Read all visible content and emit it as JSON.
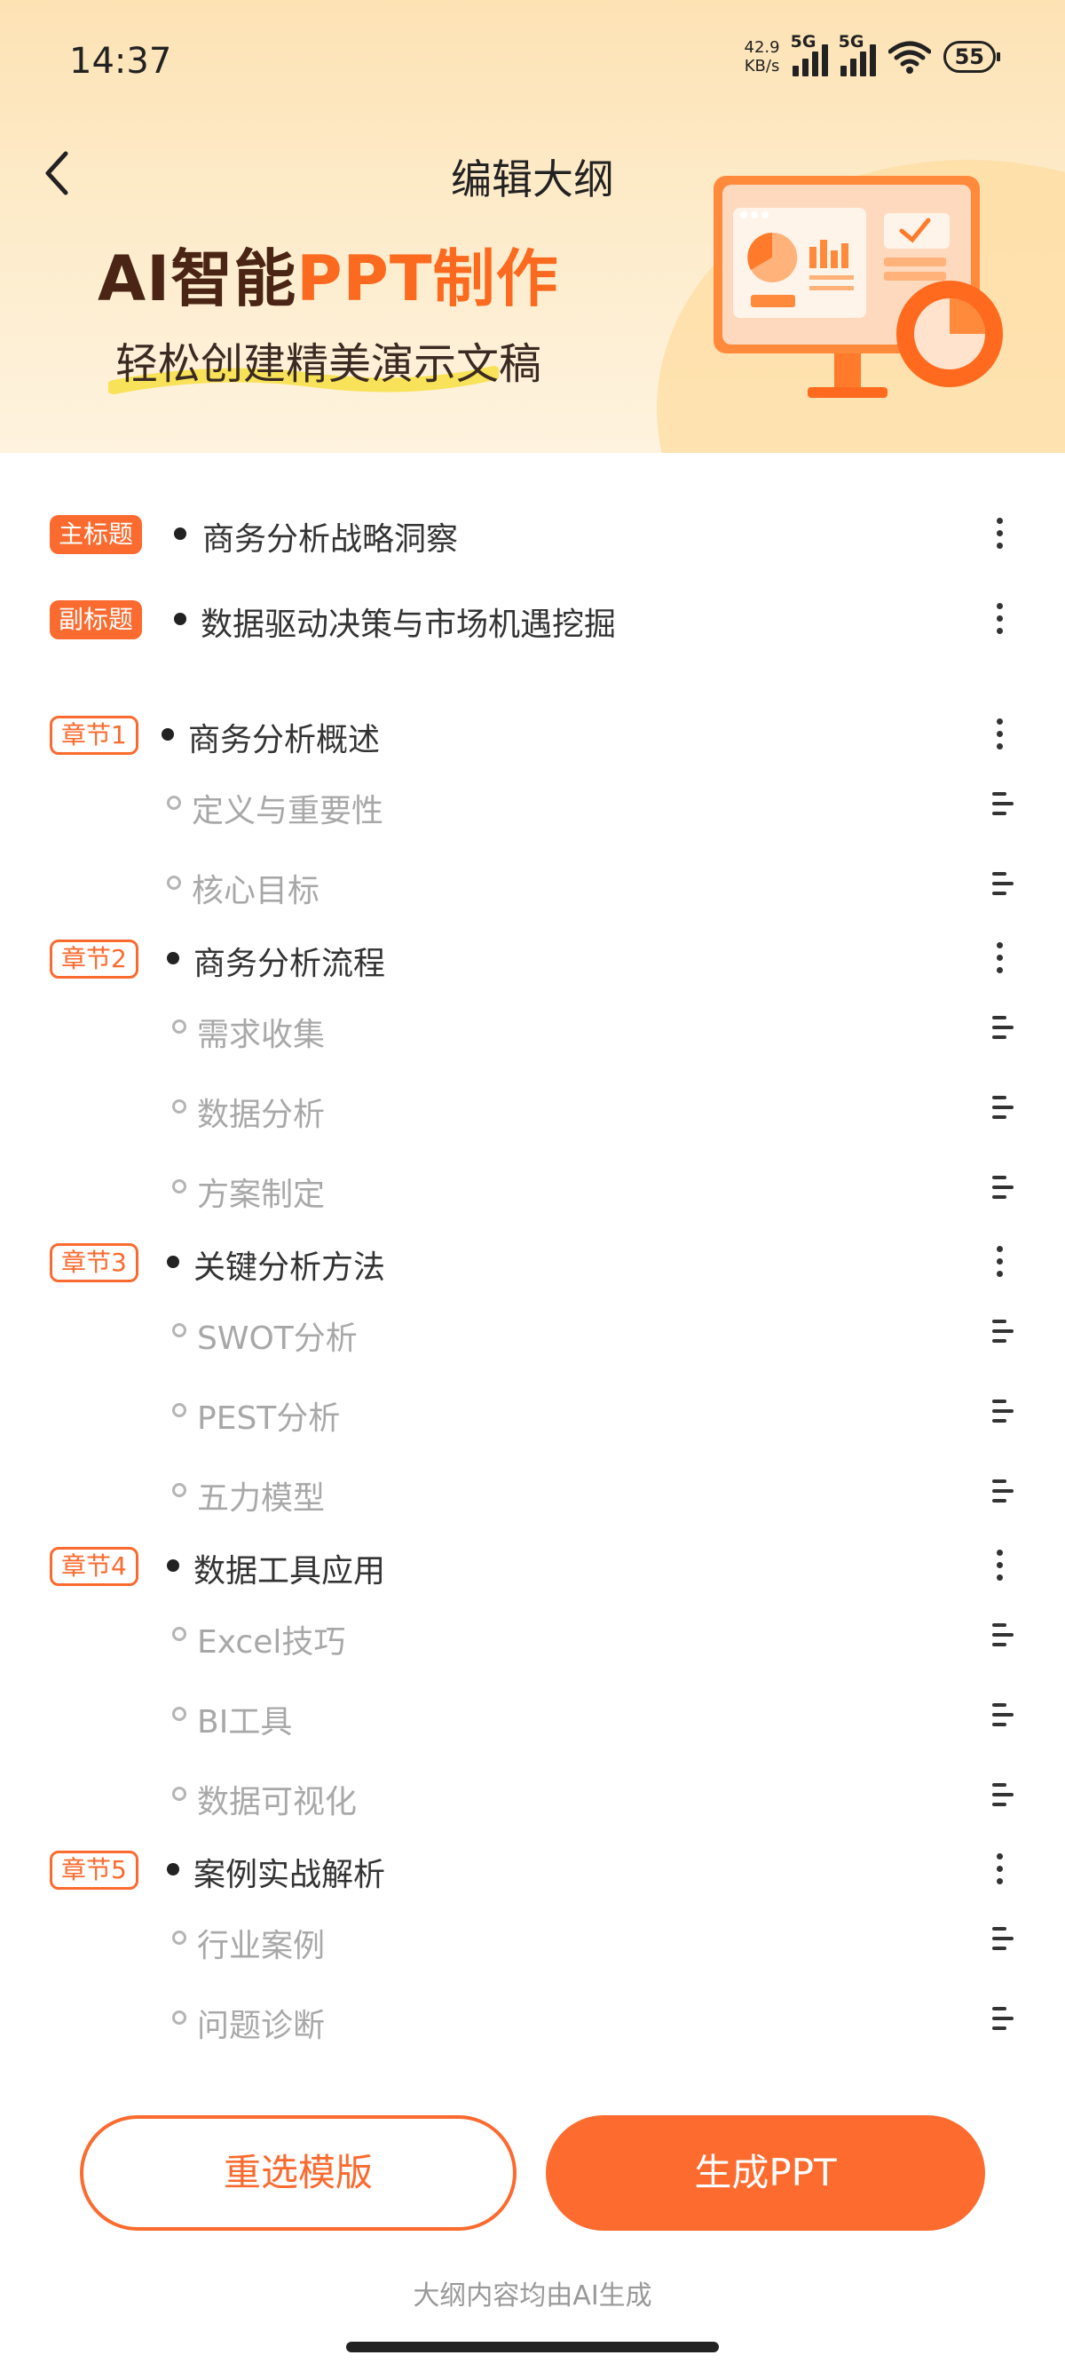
{
  "status": {
    "time": "14:37",
    "speed_value": "42.9",
    "speed_unit": "KB/s",
    "sim1": "5G",
    "sim2": "5G",
    "battery": "55",
    "icons": [
      "signal-icon",
      "signal-icon",
      "wifi-icon",
      "battery-icon"
    ]
  },
  "header": {
    "title": "编辑大纲",
    "back_icon": "chevron-left-icon"
  },
  "hero": {
    "title_dark": "AI智能",
    "title_orange": "PPT制作",
    "subtitle": "轻松创建精美演示文稿",
    "illustration": "monitor-chart-illustration"
  },
  "colors": {
    "accent": "#fb6a2e",
    "hero_bg": "#fde2b4",
    "title_dark": "#4a2414",
    "muted_text": "#a8a8a8"
  },
  "outline": {
    "main_title": {
      "badge": "主标题",
      "text": "商务分析战略洞察"
    },
    "sub_title": {
      "badge": "副标题",
      "text": "数据驱动决策与市场机遇挖掘"
    },
    "chapters": [
      {
        "badge": "章节1",
        "title": "商务分析概述",
        "items": [
          "定义与重要性",
          "核心目标"
        ]
      },
      {
        "badge": "章节2",
        "title": "商务分析流程",
        "items": [
          "需求收集",
          "数据分析",
          "方案制定"
        ]
      },
      {
        "badge": "章节3",
        "title": "关键分析方法",
        "items": [
          "SWOT分析",
          "PEST分析",
          "五力模型"
        ]
      },
      {
        "badge": "章节4",
        "title": "数据工具应用",
        "items": [
          "Excel技巧",
          "BI工具",
          "数据可视化"
        ]
      },
      {
        "badge": "章节5",
        "title": "案例实战解析",
        "items": [
          "行业案例",
          "问题诊断"
        ]
      }
    ]
  },
  "actions": {
    "reselect_label": "重选模版",
    "generate_label": "生成PPT",
    "note": "大纲内容均由AI生成"
  }
}
